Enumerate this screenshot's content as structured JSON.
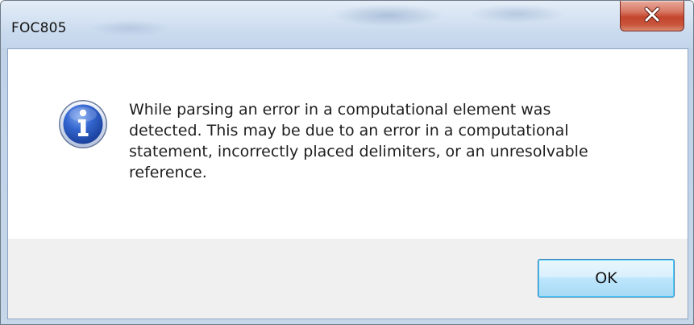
{
  "window": {
    "title": "FOC805"
  },
  "dialog": {
    "icon": "information-icon",
    "message": "While parsing an error in a computational element was\ndetected.  This may be due to an error in a computational\nstatement, incorrectly placed delimiters, or an unresolvable\nreference."
  },
  "buttons": {
    "ok_label": "OK",
    "close_icon": "close-x-icon"
  },
  "colors": {
    "close_button": "#c4452d",
    "info_icon": "#2a56b8",
    "ok_button_border": "#3c7fb1"
  }
}
